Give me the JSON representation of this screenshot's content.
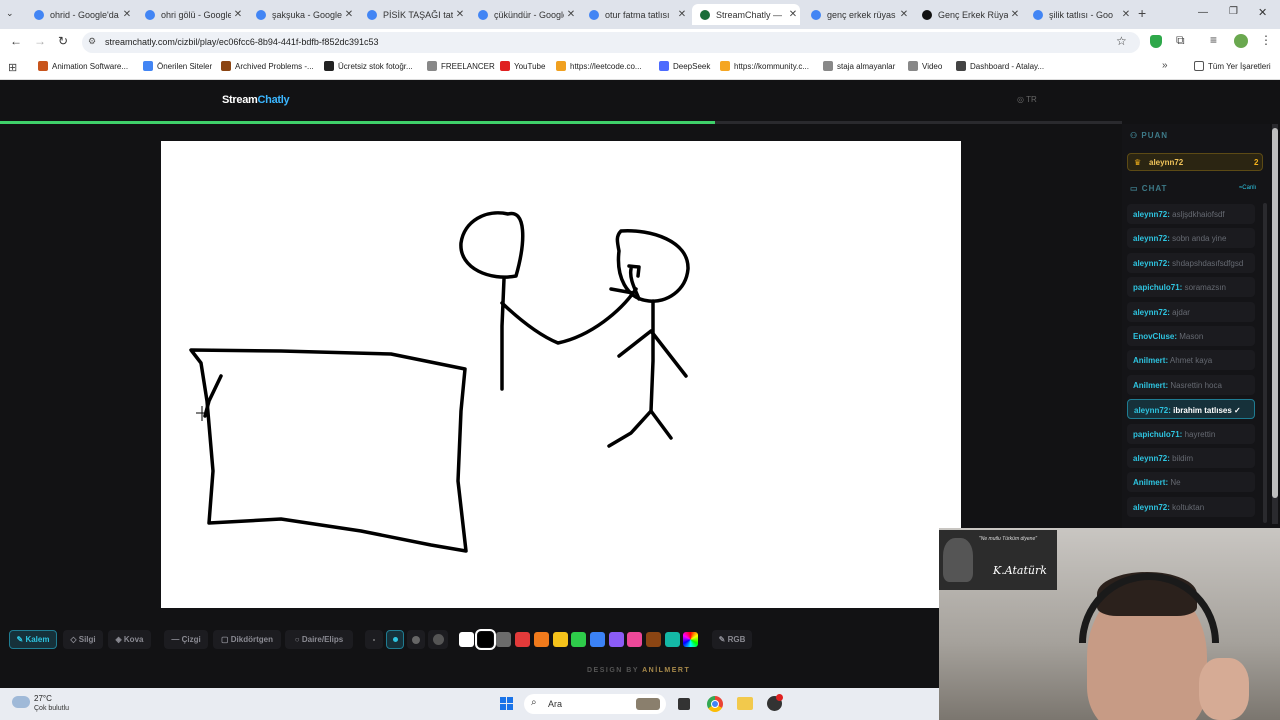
{
  "browser": {
    "tabs": [
      {
        "title": "ohrid - Google'da",
        "color": "#4285f4"
      },
      {
        "title": "ohri gölü - Google",
        "color": "#4285f4"
      },
      {
        "title": "şakşuka - Google",
        "color": "#4285f4"
      },
      {
        "title": "PİSİK TAŞAĞI tatlı",
        "color": "#4285f4"
      },
      {
        "title": "çükündür - Google",
        "color": "#4285f4"
      },
      {
        "title": "otur fatma tatlısı",
        "color": "#4285f4"
      },
      {
        "title": "StreamChatly — ",
        "color": "#1b6e3a"
      },
      {
        "title": "genç erkek rüyas",
        "color": "#4285f4"
      },
      {
        "title": "Genç Erkek Rüyas",
        "color": "#111111"
      },
      {
        "title": "şilik tatlısı - Goo",
        "color": "#4285f4"
      }
    ],
    "url": "streamchatly.com/cizbil/play/ec06fcc6-8b94-441f-bdfb-f852dc391c53",
    "bookmarks": [
      {
        "label": "Animation Software...",
        "color": "#c8551d"
      },
      {
        "label": "Önerilen Siteler",
        "color": "#4285f4"
      },
      {
        "label": "Archived Problems -...",
        "color": "#8b4513"
      },
      {
        "label": "Ücretsiz stok fotoğr...",
        "color": "#222222"
      },
      {
        "label": "FREELANCER",
        "color": "#888888"
      },
      {
        "label": "YouTube",
        "color": "#e02020"
      },
      {
        "label": "https://leetcode.co...",
        "color": "#f0a020"
      },
      {
        "label": "DeepSeek",
        "color": "#4d6bfe"
      },
      {
        "label": "https://kommunity.c...",
        "color": "#f5a623"
      },
      {
        "label": "staja almayanlar",
        "color": "#888888"
      },
      {
        "label": "Video",
        "color": "#888888"
      },
      {
        "label": "Dashboard - Atalay...",
        "color": "#444444"
      }
    ],
    "all_bookmarks": "Tüm Yer İşaretleri"
  },
  "app": {
    "logo_a": "Stream",
    "logo_b": "Chatly",
    "lang": "TR",
    "footer_a": "DESIGN BY ",
    "footer_b": "ANİLMERT"
  },
  "score": {
    "header": "PUAN",
    "player": "aleynn72",
    "points": "2"
  },
  "chat": {
    "header": "CHAT",
    "live": "Canlı",
    "messages": [
      {
        "user": "aleynn72:",
        "text": "asljşdkhaiofsdf"
      },
      {
        "user": "aleynn72:",
        "text": "sobn anda yine"
      },
      {
        "user": "aleynn72:",
        "text": "shdapshdasıfsdfgsd"
      },
      {
        "user": "papichulo71:",
        "text": "soramazsın"
      },
      {
        "user": "aleynn72:",
        "text": "ajdar"
      },
      {
        "user": "EnovCluse:",
        "text": "Mason"
      },
      {
        "user": "Anilmert:",
        "text": "Ahmet kaya"
      },
      {
        "user": "Anilmert:",
        "text": "Nasrettin hoca"
      },
      {
        "user": "aleynn72:",
        "text": "ibrahim tatlıses ✓",
        "highlight": true
      },
      {
        "user": "papichulo71:",
        "text": "hayrettin"
      },
      {
        "user": "aleynn72:",
        "text": "bildim"
      },
      {
        "user": "Anilmert:",
        "text": "Ne"
      },
      {
        "user": "aleynn72:",
        "text": "koltuktan"
      }
    ]
  },
  "tools": {
    "pen": "Kalem",
    "eraser": "Silgi",
    "bucket": "Kova",
    "line": "Çizgi",
    "rect": "Dikdörtgen",
    "ellipse": "Daire/Elips",
    "rgb": "RGB",
    "palette": [
      "#ffffff",
      "#000000",
      "#6b6b6b",
      "#e23a3a",
      "#f07a1c",
      "#f5c21b",
      "#2ecc4a",
      "#3b82f6",
      "#8b5cf6",
      "#ec4899",
      "#8b4513",
      "#14b8a6"
    ]
  },
  "taskbar": {
    "temp": "27°C",
    "weather": "Çok bulutlu",
    "search": "Ara"
  },
  "webcam": {
    "poster_text": "\"Ne mutlu Türküm diyene\""
  }
}
